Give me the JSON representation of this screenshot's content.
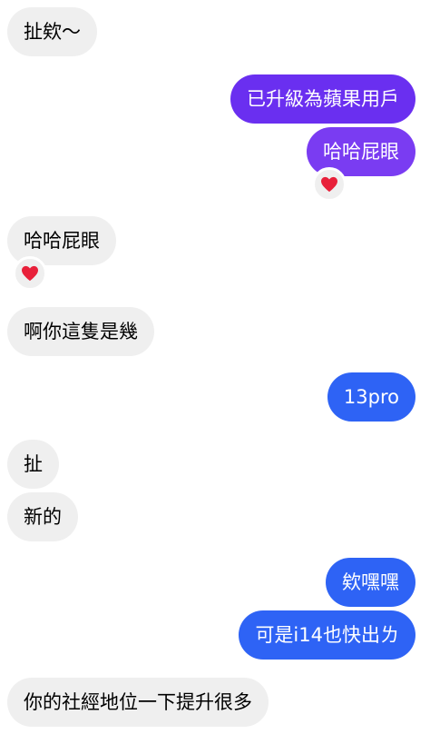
{
  "colors": {
    "incoming_bg": "#efefef",
    "outgoing_purple": "#6a2ff0",
    "outgoing_violet": "#7a3cf2",
    "outgoing_blue": "#2e63f5",
    "heart": "#e8203a"
  },
  "messages": [
    {
      "side": "incoming",
      "text": "扯欸～"
    },
    {
      "side": "outgoing",
      "text": "已升級為蘋果用戶"
    },
    {
      "side": "outgoing",
      "text": "哈哈屁眼",
      "reaction": "heart-icon"
    },
    {
      "side": "incoming",
      "text": "哈哈屁眼",
      "reaction": "heart-icon"
    },
    {
      "side": "incoming",
      "text": "啊你這隻是幾"
    },
    {
      "side": "outgoing",
      "text": "13pro"
    },
    {
      "side": "incoming",
      "text": "扯"
    },
    {
      "side": "incoming",
      "text": "新的"
    },
    {
      "side": "outgoing",
      "text": "欸嘿嘿"
    },
    {
      "side": "outgoing",
      "text": "可是i14也快出ㄌ"
    },
    {
      "side": "incoming",
      "text": "你的社經地位一下提升很多"
    }
  ]
}
